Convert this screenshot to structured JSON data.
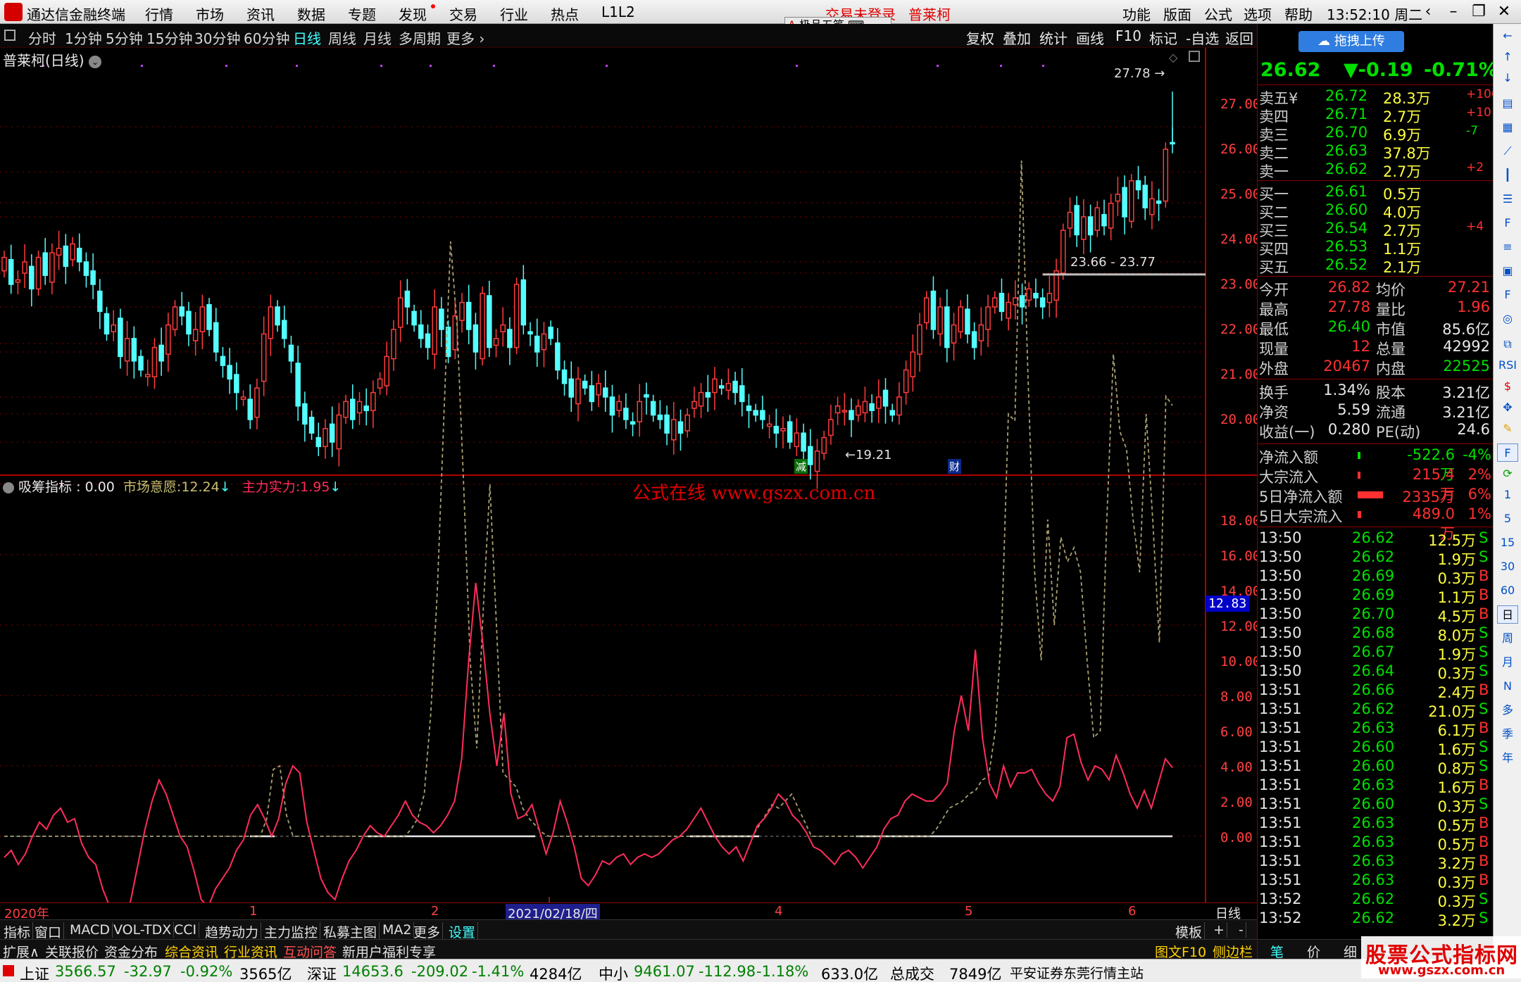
{
  "titlebar": {
    "app_title": "通达信金融终端",
    "menus": [
      "行情",
      "市场",
      "资讯",
      "数据",
      "专题",
      "发现",
      "交易",
      "行业",
      "热点",
      "L1L2"
    ],
    "trade_status": "交易未登录",
    "stock_name": "普莱柯",
    "right_menus": [
      "功能",
      "版面",
      "公式",
      "选项",
      "帮助"
    ],
    "time": "13:52:10",
    "weekday": "周二",
    "mini_toolbar": "极品五笔"
  },
  "periodbar": {
    "items": [
      "分时",
      "1分钟",
      "5分钟",
      "15分钟",
      "30分钟",
      "60分钟",
      "日线",
      "周线",
      "月线",
      "多周期",
      "更多"
    ],
    "active": "日线",
    "right_items": [
      "复权",
      "叠加",
      "统计",
      "画线",
      "F10",
      "标记",
      "-自选",
      "返回"
    ]
  },
  "main_chart": {
    "title": "普莱柯(日线)",
    "high_marker": "27.78",
    "low_marker": "19.21",
    "gap_label": "23.66 - 23.77",
    "events": [
      "减",
      "财"
    ],
    "y_axis": [
      "27.00",
      "26.00",
      "25.00",
      "24.00",
      "23.00",
      "22.00",
      "21.00",
      "20.00"
    ],
    "colors": {
      "up": "#ff3c3c",
      "down": "#54ffff",
      "grid": "#8b0000"
    }
  },
  "indicator": {
    "name": "吸筹指标",
    "value": "0.00",
    "line1_label": "市场意愿:",
    "line1_value": "12.24",
    "line2_label": "主力实力:",
    "line2_value": "1.95",
    "watermark": "公式在线  www.gszx.com.cn",
    "current_tag": "12.83",
    "y_axis": [
      "18.00",
      "16.00",
      "14.00",
      "12.00",
      "10.00",
      "8.00",
      "6.00",
      "4.00",
      "2.00",
      "0.00"
    ]
  },
  "chart_data": [
    {
      "type": "candlestick",
      "title": "普莱柯(日线)",
      "ylim": [
        19.0,
        28.0
      ],
      "x_ticks": [
        "2020年",
        "1",
        "2",
        "2021/02/18/四",
        "4",
        "5",
        "6"
      ],
      "y_ticks": [
        20,
        21,
        22,
        23,
        24,
        25,
        26,
        27
      ],
      "high": 27.78,
      "low": 19.21,
      "closes": [
        24.1,
        23.5,
        23.6,
        24.0,
        23.4,
        24.1,
        23.7,
        24.2,
        24.3,
        23.9,
        24.4,
        24.0,
        23.7,
        23.5,
        22.9,
        22.4,
        22.6,
        21.9,
        22.3,
        21.8,
        21.6,
        21.5,
        22.1,
        21.8,
        22.6,
        23.0,
        22.8,
        22.4,
        22.5,
        23.0,
        22.5,
        22.0,
        21.7,
        21.4,
        21.1,
        21.0,
        20.5,
        21.2,
        22.4,
        23.0,
        22.6,
        22.3,
        21.8,
        20.8,
        20.4,
        20.2,
        19.9,
        20.3,
        20.0,
        20.6,
        20.9,
        20.5,
        20.9,
        20.7,
        21.1,
        21.4,
        21.9,
        22.5,
        23.2,
        23.0,
        22.6,
        22.3,
        22.1,
        23.0,
        22.5,
        21.9,
        22.8,
        23.1,
        22.5,
        22.0,
        23.3,
        22.1,
        22.3,
        22.6,
        22.1,
        23.5,
        22.6,
        22.4,
        22.0,
        22.4,
        22.3,
        21.6,
        21.3,
        21.0,
        21.4,
        21.2,
        20.9,
        21.3,
        21.0,
        20.6,
        20.9,
        20.5,
        20.4,
        20.9,
        21.0,
        20.6,
        20.5,
        20.2,
        20.5,
        20.2,
        20.6,
        20.9,
        21.1,
        21.0,
        21.4,
        21.2,
        21.3,
        21.1,
        20.9,
        20.7,
        20.6,
        20.5,
        20.4,
        20.2,
        20.3,
        20.0,
        20.2,
        19.8,
        19.5,
        19.8,
        20.1,
        20.5,
        20.8,
        20.7,
        20.5,
        20.8,
        20.9,
        20.7,
        21.0,
        20.8,
        20.6,
        21.0,
        21.6,
        22.0,
        22.6,
        23.2,
        22.5,
        23.0,
        22.1,
        22.6,
        23.0,
        22.4,
        22.1,
        22.6,
        23.0,
        23.2,
        22.9,
        23.1,
        23.2,
        23.0,
        23.4,
        23.2,
        23.0,
        23.3,
        23.8,
        24.7,
        25.1,
        24.6,
        25.0,
        24.6,
        25.2,
        24.8,
        25.3,
        25.5,
        25.0,
        25.8,
        25.6,
        25.2,
        25.4,
        25.3,
        26.5,
        26.62
      ],
      "ma_gap": [
        23.66,
        23.77
      ]
    },
    {
      "type": "line",
      "title": "吸筹指标",
      "ylim": [
        -3.5,
        19.5
      ],
      "series": [
        {
          "name": "市场意愿",
          "color": "#a8a070",
          "style": "dashed",
          "values": [
            0,
            0,
            0,
            0,
            0,
            0,
            0,
            0,
            0,
            0,
            0,
            0,
            0,
            0,
            0,
            0,
            0,
            0,
            0,
            0,
            0,
            0,
            0,
            0,
            0,
            0,
            0,
            0,
            0,
            0,
            0,
            0,
            0,
            0,
            0,
            0,
            0,
            0,
            0,
            0,
            0.5,
            1.9,
            2.0,
            0.6,
            0,
            0,
            0,
            0,
            0,
            0,
            0,
            0,
            0,
            0,
            0,
            0,
            0,
            0,
            0,
            0,
            0,
            0,
            0.2,
            0.5,
            1.2,
            3.5,
            7.0,
            12.0,
            16.9,
            14.5,
            10.0,
            5.0,
            2.5,
            6.5,
            10.0,
            6.0,
            1.8,
            1.6,
            1.4,
            0.8,
            0.5,
            0.3,
            0.1,
            0,
            0,
            0,
            0,
            0,
            0,
            0,
            0,
            0,
            0,
            0,
            0,
            0,
            0,
            0,
            0,
            0,
            0,
            0,
            0,
            0,
            0,
            0,
            0,
            0,
            0,
            0,
            0,
            0,
            0,
            0,
            0,
            0.3,
            0.6,
            0.9,
            0.8,
            1.0,
            1.2,
            0.8,
            0.4,
            0,
            0,
            0,
            0,
            0,
            0,
            0,
            0,
            0,
            0,
            0,
            0,
            0,
            0,
            0,
            0,
            0,
            0,
            0,
            0.2,
            0.5,
            0.8,
            0.9,
            1.0,
            1.2,
            1.3,
            1.6,
            1.7,
            3.0,
            6.0,
            12.0,
            11.8,
            19.2,
            13.0,
            7.5,
            5.0,
            9.0,
            6.0,
            8.5,
            7.8,
            8.2,
            7.5,
            5.0,
            2.8,
            3.0,
            9.0,
            13.7,
            11.5,
            11.0,
            9.0,
            7.5,
            12.0,
            9.0,
            5.5,
            12.5,
            12.24
          ]
        },
        {
          "name": "主力实力",
          "color": "#ff2d5a",
          "style": "solid",
          "values": [
            -0.6,
            -0.4,
            -0.8,
            -0.5,
            0.0,
            0.4,
            0.2,
            0.6,
            0.8,
            0.4,
            0.5,
            -0.2,
            -0.6,
            -0.8,
            -1.5,
            -2.0,
            -2.8,
            -2.5,
            -1.8,
            -0.8,
            0.2,
            1.0,
            1.6,
            1.2,
            0.6,
            0.0,
            -0.3,
            -1.0,
            -1.8,
            -2.0,
            -1.5,
            -1.2,
            -0.9,
            -0.4,
            -0.1,
            0.6,
            0.9,
            0.5,
            0.0,
            0.5,
            1.5,
            2.0,
            1.8,
            0.4,
            -0.4,
            -1.2,
            -1.6,
            -1.8,
            -1.2,
            -0.7,
            -0.4,
            0.0,
            0.3,
            0.1,
            0.0,
            0.3,
            0.6,
            1.0,
            0.6,
            0.4,
            0.3,
            0.1,
            0.3,
            0.6,
            1.0,
            2.2,
            5.0,
            7.2,
            5.5,
            3.5,
            2.0,
            3.5,
            1.2,
            0.5,
            0.6,
            0.9,
            0.2,
            -0.5,
            0.1,
            1.0,
            0.4,
            -0.3,
            -1.2,
            -1.4,
            -1.1,
            -0.7,
            -0.8,
            -0.6,
            -0.5,
            -0.8,
            -0.6,
            -0.5,
            -0.6,
            -0.5,
            -0.3,
            -0.1,
            0.0,
            0.2,
            0.5,
            0.8,
            0.4,
            0.0,
            -0.3,
            -0.5,
            -0.3,
            -0.7,
            -0.2,
            0.3,
            0.5,
            0.8,
            1.2,
            1.0,
            0.6,
            0.4,
            0.1,
            -0.3,
            -0.4,
            -0.6,
            -0.8,
            -0.5,
            -0.4,
            -0.6,
            -0.9,
            -0.6,
            -0.3,
            0.2,
            0.5,
            0.6,
            1.0,
            1.2,
            1.1,
            1.0,
            1.0,
            1.2,
            1.5,
            3.0,
            4.0,
            3.0,
            5.3,
            2.8,
            1.5,
            1.1,
            2.0,
            1.4,
            1.8,
            1.8,
            1.9,
            1.5,
            1.2,
            1.0,
            1.4,
            2.8,
            2.9,
            2.1,
            1.6,
            2.0,
            1.9,
            1.6,
            2.3,
            1.8,
            1.2,
            0.8,
            1.3,
            0.8,
            1.5,
            2.2,
            1.95
          ]
        }
      ]
    }
  ],
  "datebar": {
    "labels": [
      "2020年",
      "1",
      "2",
      "2021/02/18/四",
      "4",
      "5",
      "6"
    ],
    "period": "日线"
  },
  "tabbar1": {
    "items": [
      "指标",
      "窗口",
      "MACD",
      "VOL-TDX",
      "CCI",
      "趋势动力",
      "主力监控",
      "私募主图",
      "MA2",
      "更多",
      "设置"
    ],
    "active": "设置",
    "right_items": [
      "模板",
      "+",
      "-"
    ]
  },
  "tabbar2": {
    "items": [
      "扩展∧",
      "关联报价",
      "资金分布",
      "综合资讯",
      "行业资讯",
      "互动问答",
      "新用户福利专享"
    ],
    "right_items": [
      "图文F10",
      "侧边栏 《",
      "笔",
      "价",
      "细",
      "势"
    ]
  },
  "ticker": {
    "sh_label": "上证",
    "sh_value": "3566.57",
    "sh_change": "-32.97",
    "sh_pct": "-0.92%",
    "sh_amount": "3565亿",
    "sz_label": "深证",
    "sz_value": "14653.6",
    "sz_change": "-209.02",
    "sz_pct": "-1.41%",
    "sz_amount": "4284亿",
    "zx_label": "中小",
    "zx_value": "9461.07",
    "zx_change": "-112.98",
    "zx_pct": "-1.18%",
    "zx_amount": "633.0亿",
    "total_label": "总成交",
    "total_value": "7849亿",
    "broker": "平安证券东莞行情主站"
  },
  "quote": {
    "upload_label": "拖拽上传",
    "price": "26.62",
    "change": "▼-0.19",
    "pct": "-0.71%",
    "asks": [
      {
        "label": "卖五",
        "price": "26.72",
        "vol": "28.3万",
        "chg": "+106"
      },
      {
        "label": "卖四",
        "price": "26.71",
        "vol": "2.7万",
        "chg": "+10"
      },
      {
        "label": "卖三",
        "price": "26.70",
        "vol": "6.9万",
        "chg": "-7"
      },
      {
        "label": "卖二",
        "price": "26.63",
        "vol": "37.8万",
        "chg": ""
      },
      {
        "label": "卖一",
        "price": "26.62",
        "vol": "2.7万",
        "chg": "+2"
      }
    ],
    "bids": [
      {
        "label": "买一",
        "price": "26.61",
        "vol": "0.5万",
        "chg": ""
      },
      {
        "label": "买二",
        "price": "26.60",
        "vol": "4.0万",
        "chg": ""
      },
      {
        "label": "买三",
        "price": "26.54",
        "vol": "2.7万",
        "chg": "+4"
      },
      {
        "label": "买四",
        "price": "26.53",
        "vol": "1.1万",
        "chg": ""
      },
      {
        "label": "买五",
        "price": "26.52",
        "vol": "2.1万",
        "chg": ""
      }
    ],
    "stats": [
      {
        "l1": "今开",
        "v1": "26.82",
        "l2": "均价",
        "v2": "27.21"
      },
      {
        "l1": "最高",
        "v1": "27.78",
        "l2": "量比",
        "v2": "1.96"
      },
      {
        "l1": "最低",
        "v1": "26.40",
        "l2": "市值",
        "v2": "85.6亿"
      },
      {
        "l1": "现量",
        "v1": "12",
        "l2": "总量",
        "v2": "42992"
      },
      {
        "l1": "外盘",
        "v1": "20467",
        "l2": "内盘",
        "v2": "22525"
      }
    ],
    "fundamentals": [
      {
        "l1": "换手",
        "v1": "1.34%",
        "l2": "股本",
        "v2": "3.21亿"
      },
      {
        "l1": "净资",
        "v1": "5.59",
        "l2": "流通",
        "v2": "3.21亿"
      },
      {
        "l1": "收益(一)",
        "v1": "0.280",
        "l2": "PE(动)",
        "v2": "24.6"
      }
    ],
    "flows": [
      {
        "label": "净流入额",
        "value": "-522.6万",
        "pct": "-4%",
        "bar": 0.06
      },
      {
        "label": "大宗流入",
        "value": "215.4万",
        "pct": "2%",
        "bar": 0.03
      },
      {
        "label": "5日净流入额",
        "value": "2335万",
        "pct": "6%",
        "bar": 0.7
      },
      {
        "label": "5日大宗流入",
        "value": "489.0万",
        "pct": "1%",
        "bar": 0.1
      }
    ],
    "ticks": [
      {
        "t": "13:50",
        "p": "26.62",
        "v": "12.5万",
        "s": "S"
      },
      {
        "t": "13:50",
        "p": "26.62",
        "v": "1.9万",
        "s": "S"
      },
      {
        "t": "13:50",
        "p": "26.69",
        "v": "0.3万",
        "s": "B"
      },
      {
        "t": "13:50",
        "p": "26.69",
        "v": "1.1万",
        "s": "B"
      },
      {
        "t": "13:50",
        "p": "26.70",
        "v": "4.5万",
        "s": "B"
      },
      {
        "t": "13:50",
        "p": "26.68",
        "v": "8.0万",
        "s": "S"
      },
      {
        "t": "13:50",
        "p": "26.67",
        "v": "1.9万",
        "s": "S"
      },
      {
        "t": "13:50",
        "p": "26.64",
        "v": "0.3万",
        "s": "S"
      },
      {
        "t": "13:51",
        "p": "26.66",
        "v": "2.4万",
        "s": "B"
      },
      {
        "t": "13:51",
        "p": "26.62",
        "v": "21.0万",
        "s": "S"
      },
      {
        "t": "13:51",
        "p": "26.63",
        "v": "6.1万",
        "s": "B"
      },
      {
        "t": "13:51",
        "p": "26.60",
        "v": "1.6万",
        "s": "S"
      },
      {
        "t": "13:51",
        "p": "26.60",
        "v": "0.8万",
        "s": "S"
      },
      {
        "t": "13:51",
        "p": "26.63",
        "v": "1.6万",
        "s": "B"
      },
      {
        "t": "13:51",
        "p": "26.60",
        "v": "0.3万",
        "s": "S"
      },
      {
        "t": "13:51",
        "p": "26.63",
        "v": "0.5万",
        "s": "B"
      },
      {
        "t": "13:51",
        "p": "26.63",
        "v": "0.5万",
        "s": "B"
      },
      {
        "t": "13:51",
        "p": "26.63",
        "v": "3.2万",
        "s": "B"
      },
      {
        "t": "13:51",
        "p": "26.63",
        "v": "0.3万",
        "s": "B"
      },
      {
        "t": "13:52",
        "p": "26.62",
        "v": "0.3万",
        "s": "S"
      },
      {
        "t": "13:52",
        "p": "26.62",
        "v": "3.2万",
        "s": "S"
      }
    ]
  },
  "vtool": {
    "text_items": [
      "RSI",
      "1",
      "5",
      "15",
      "30",
      "60",
      "日",
      "周",
      "月",
      "N",
      "多",
      "季",
      "年"
    ]
  },
  "watermark": {
    "line1": "股票公式指标网",
    "line2": "www.gszx.com.cn"
  }
}
